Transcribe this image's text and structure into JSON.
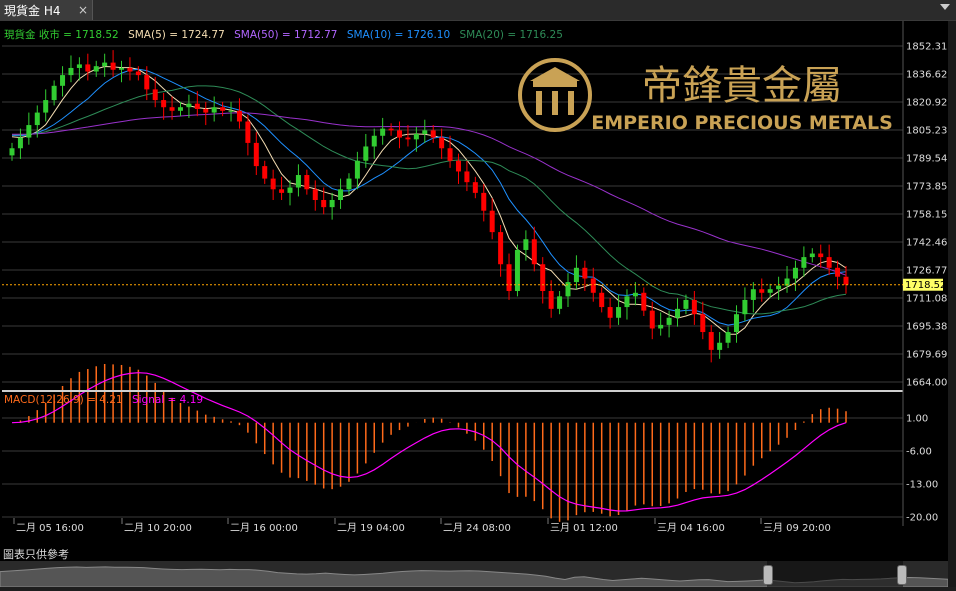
{
  "tab": {
    "title": "現貨金 H4",
    "close_label": "×"
  },
  "legend": {
    "price": "現貨金 收市 = 1718.52",
    "sma5": "SMA(5) = 1724.77",
    "sma50": "SMA(50) = 1712.77",
    "sma10": "SMA(10) = 1726.10",
    "sma20": "SMA(20) = 1716.25"
  },
  "macd_legend": {
    "macd": "MACD(12,26,9) = 4.21",
    "signal": "Signal = 4.19"
  },
  "logo": {
    "chinese": "帝鋒貴金屬",
    "english": "EMPERIO PRECIOUS METALS"
  },
  "price_tag": "1718.52",
  "price_tag_overlap": "1711.08",
  "footnote": "圖表只供參考",
  "colors": {
    "background": "#000000",
    "bull": "#32cd32",
    "bear": "#ff0000",
    "sma5": "#f5deb3",
    "sma10": "#1e90ff",
    "sma20": "#2e8b57",
    "sma50": "#9932cc",
    "macd_hist": "#ff6a1a",
    "signal": "#ff00ff",
    "price_line": "#ffa500",
    "logo_gold": "#c9a255"
  },
  "chart_data": [
    {
      "type": "candlestick",
      "title": "現貨金 H4",
      "y_ticks": [
        "1852.31",
        "1836.62",
        "1820.92",
        "1805.23",
        "1789.54",
        "1773.85",
        "1758.15",
        "1742.46",
        "1726.77",
        "1711.08",
        "1695.38",
        "1679.69",
        "1664.00"
      ],
      "ylim": [
        1664.0,
        1856.0
      ],
      "x_ticks": [
        "二月 05 16:00",
        "二月 10 20:00",
        "二月 16 00:00",
        "二月 19 04:00",
        "二月 24 08:00",
        "三月 01 12:00",
        "三月 04 16:00",
        "三月 09 20:00"
      ],
      "last_close": 1718.52,
      "close_series": [
        1795,
        1801,
        1808,
        1815,
        1822,
        1830,
        1836,
        1840,
        1842,
        1838,
        1841,
        1843,
        1839,
        1840,
        1838,
        1836,
        1828,
        1822,
        1818,
        1816,
        1818,
        1820,
        1817,
        1815,
        1818,
        1816,
        1816,
        1810,
        1798,
        1785,
        1778,
        1772,
        1770,
        1773,
        1780,
        1772,
        1766,
        1762,
        1766,
        1772,
        1778,
        1788,
        1796,
        1802,
        1806,
        1805,
        1801,
        1800,
        1803,
        1805,
        1801,
        1795,
        1788,
        1782,
        1776,
        1770,
        1760,
        1748,
        1730,
        1715,
        1738,
        1744,
        1730,
        1715,
        1705,
        1712,
        1720,
        1728,
        1722,
        1714,
        1706,
        1700,
        1706,
        1712,
        1714,
        1704,
        1694,
        1696,
        1700,
        1705,
        1710,
        1702,
        1692,
        1682,
        1686,
        1692,
        1702,
        1710,
        1716,
        1714,
        1716,
        1718,
        1722,
        1728,
        1734,
        1736,
        1734,
        1728,
        1723,
        1718.52
      ],
      "series": [
        {
          "name": "SMA(5)",
          "last": 1724.77
        },
        {
          "name": "SMA(10)",
          "last": 1726.1
        },
        {
          "name": "SMA(20)",
          "last": 1716.25
        },
        {
          "name": "SMA(50)",
          "last": 1712.77
        }
      ]
    },
    {
      "type": "bar",
      "title": "MACD(12,26,9)",
      "y_ticks": [
        "1.00",
        "-6.00",
        "-13.00",
        "-20.00"
      ],
      "ylim": [
        -21.5,
        4.0
      ],
      "macd_last": 4.21,
      "signal_last": 4.19
    }
  ]
}
